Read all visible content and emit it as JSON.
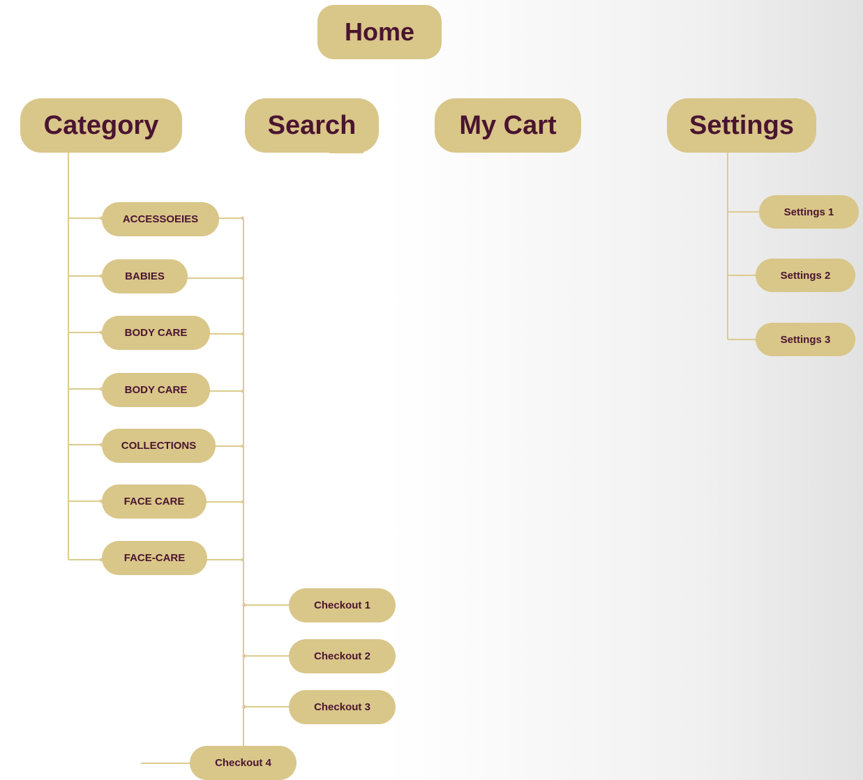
{
  "home": {
    "label": "Home"
  },
  "main_nav": {
    "category": "Category",
    "search": "Search",
    "my_cart": "My Cart",
    "settings": "Settings"
  },
  "category_items": [
    "ACCESSOEIES",
    "BABIES",
    "BODY CARE",
    "BODY CARE",
    "COLLECTIONS",
    "FACE CARE",
    "FACE-CARE"
  ],
  "checkout_items": [
    "Checkout 1",
    "Checkout 2",
    "Checkout 3",
    "Checkout 4"
  ],
  "settings_items": [
    "Settings 1",
    "Settings 2",
    "Settings 3"
  ],
  "colors": {
    "node_fill": "#d9c689",
    "text": "#4a1430",
    "connector": "#dccb8f"
  }
}
